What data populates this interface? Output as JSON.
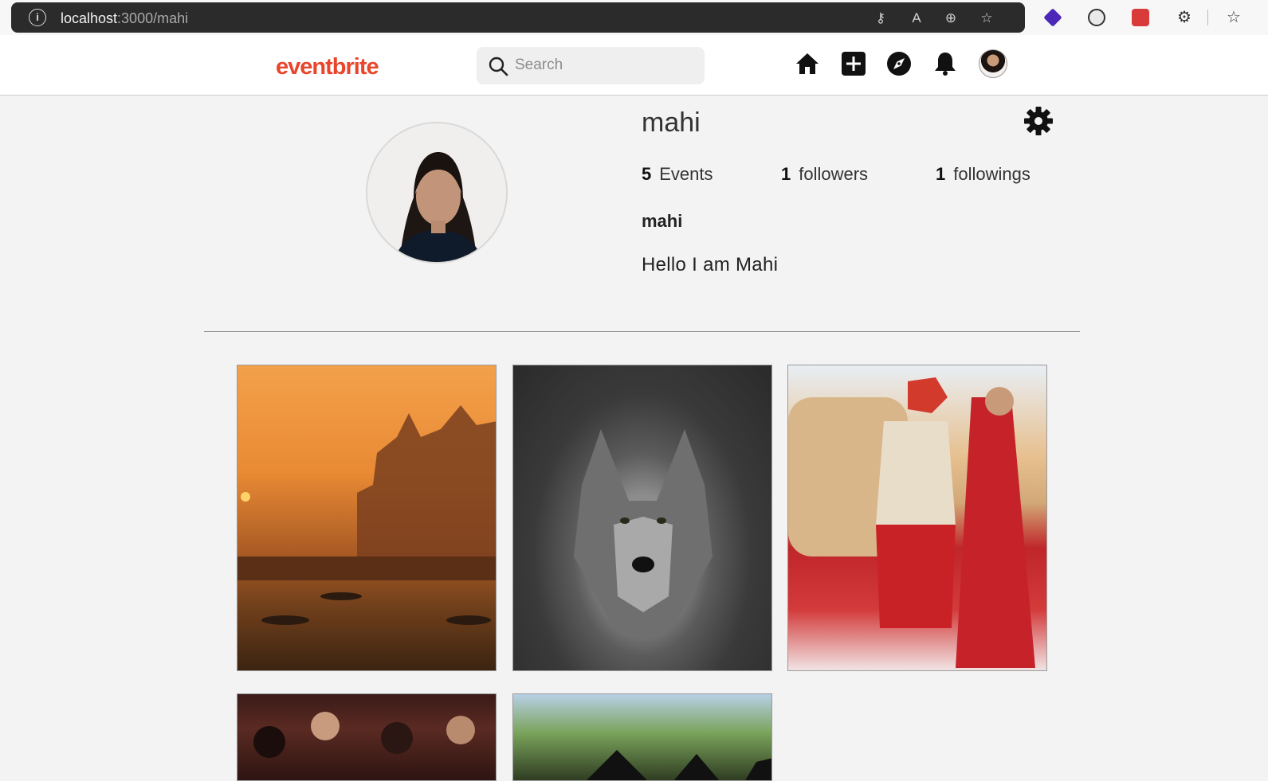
{
  "browser": {
    "url_host": "localhost",
    "url_path": ":3000/mahi"
  },
  "header": {
    "logo": "eventbrite",
    "search_placeholder": "Search"
  },
  "profile": {
    "username": "mahi",
    "stats": [
      {
        "count": "5",
        "label": "Events"
      },
      {
        "count": "1",
        "label": "followers"
      },
      {
        "count": "1",
        "label": "followings"
      }
    ],
    "display_name": "mahi",
    "bio": "Hello I am Mahi"
  },
  "posts": [
    {
      "icon": "temple-sunset-image"
    },
    {
      "icon": "wolf-image"
    },
    {
      "icon": "wedding-couple-image"
    },
    {
      "icon": "crowd-image"
    },
    {
      "icon": "graduation-image"
    }
  ],
  "colors": {
    "brand": "#e8452c",
    "background": "#f3f3f3"
  }
}
